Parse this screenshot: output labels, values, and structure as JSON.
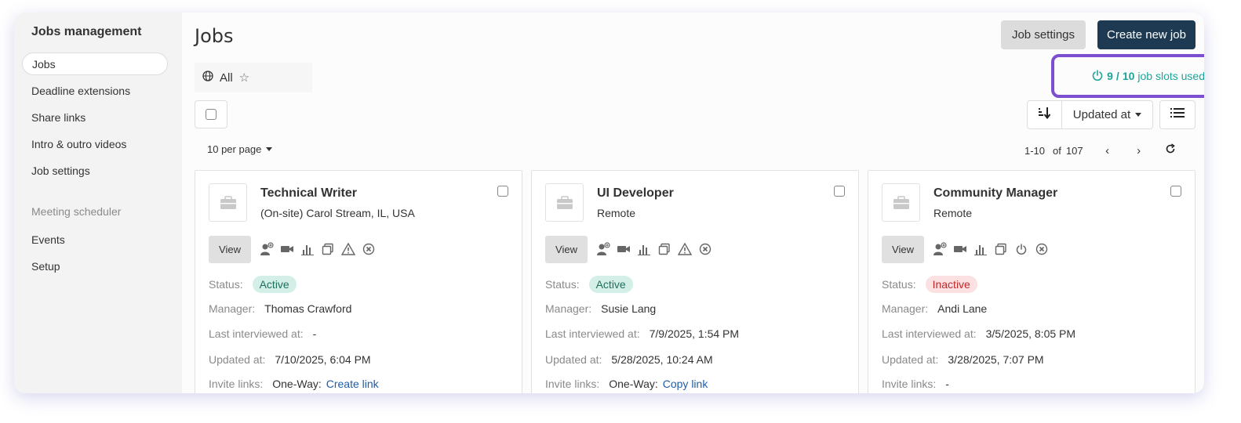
{
  "sidebar": {
    "title": "Jobs management",
    "items": [
      "Jobs",
      "Deadline extensions",
      "Share links",
      "Intro & outro videos",
      "Job settings"
    ],
    "section_label": "Meeting scheduler",
    "section_items": [
      "Events",
      "Setup"
    ]
  },
  "header": {
    "title": "Jobs",
    "settings_label": "Job settings",
    "create_label": "Create new job"
  },
  "filter": {
    "label": "All"
  },
  "slots": {
    "used": "9",
    "total": "10",
    "text": "job slots used",
    "highlight_color": "#7c4fd1"
  },
  "sort": {
    "field": "Updated at"
  },
  "paging": {
    "per_page": "10 per page",
    "range": "1-10",
    "of": "of",
    "total": "107"
  },
  "labels": {
    "status": "Status:",
    "manager": "Manager:",
    "last_interviewed": "Last interviewed at:",
    "updated": "Updated at:",
    "invite": "Invite links:",
    "view": "View"
  },
  "cards": [
    {
      "title": "Technical Writer",
      "location": "(On-site) Carol Stream, IL, USA",
      "status": "Active",
      "manager": "Thomas Crawford",
      "last_interviewed": "-",
      "updated": "7/10/2025, 6:04 PM",
      "invite_prefix": "One-Way:",
      "invite_link": "Create link"
    },
    {
      "title": "UI Developer",
      "location": "Remote",
      "status": "Active",
      "manager": "Susie Lang",
      "last_interviewed": "7/9/2025, 1:54 PM",
      "updated": "5/28/2025, 10:24 AM",
      "invite_prefix": "One-Way:",
      "invite_link": "Copy link"
    },
    {
      "title": "Community Manager",
      "location": "Remote",
      "status": "Inactive",
      "manager": "Andi Lane",
      "last_interviewed": "3/5/2025, 8:05 PM",
      "updated": "3/28/2025, 7:07 PM",
      "invite_prefix": "-",
      "invite_link": ""
    }
  ],
  "colors": {
    "accent": "#1ea39a",
    "primary_button": "#1d3a52",
    "link": "#1f5da8"
  }
}
